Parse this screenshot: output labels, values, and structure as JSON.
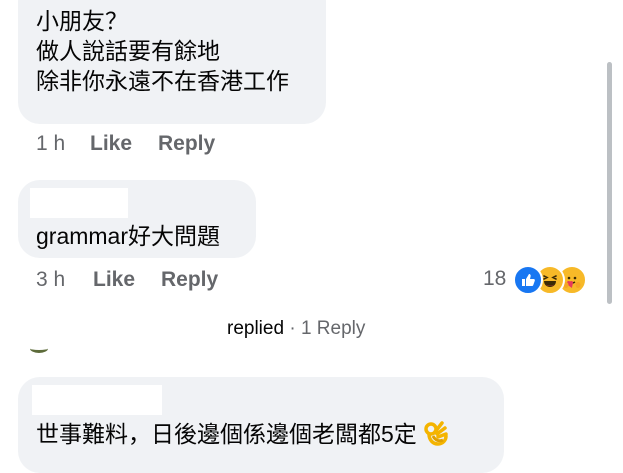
{
  "comments": [
    {
      "lines": [
        "小朋友？",
        "做人說話要有餘地",
        "除非你永遠不在香港工作"
      ],
      "time": "1 h",
      "like": "Like",
      "reply": "Reply"
    },
    {
      "lines": [
        "grammar好大問題"
      ],
      "time": "3 h",
      "like": "Like",
      "reply": "Reply",
      "reaction_count": "18",
      "reaction_icons": [
        "like-icon",
        "haha-icon",
        "care-icon"
      ]
    }
  ],
  "replies_link": {
    "replied": "replied",
    "separator": " · ",
    "count": "1 Reply"
  },
  "reply_comment": {
    "text": "世事難料，日後邊個係邊個老闆都5定",
    "emoji": "ok-hand-icon"
  },
  "colors": {
    "bubble": "#f0f2f5",
    "meta": "#65676b",
    "like_blue": "#1877f2",
    "haha_yellow": "#f7b928"
  }
}
